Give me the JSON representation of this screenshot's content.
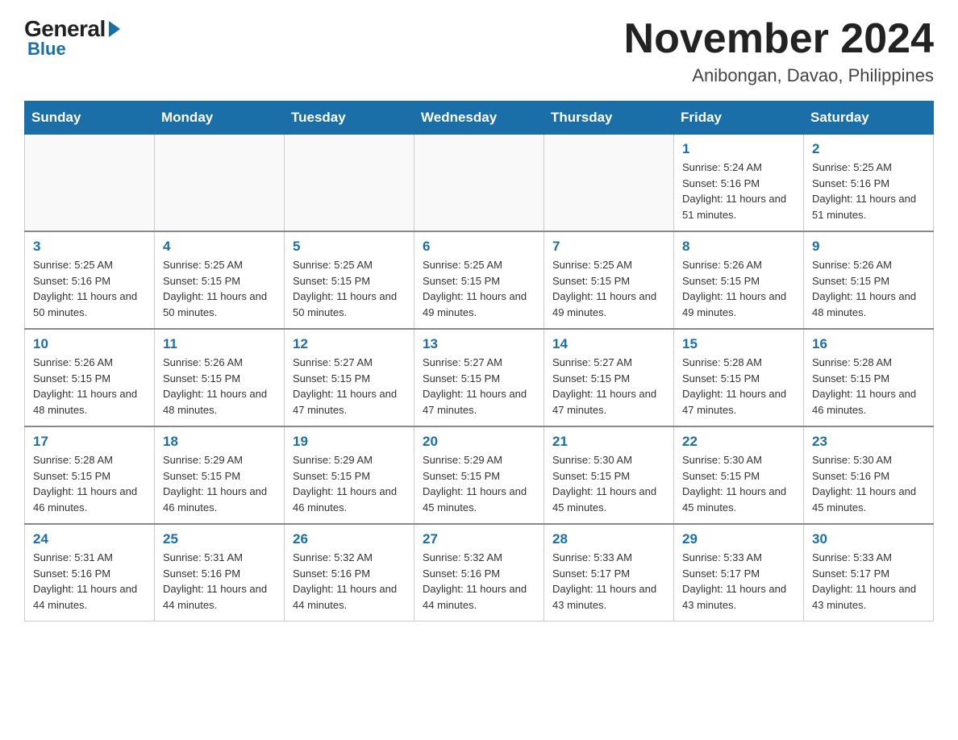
{
  "logo": {
    "general": "General",
    "blue": "Blue"
  },
  "title": {
    "month": "November 2024",
    "location": "Anibongan, Davao, Philippines"
  },
  "weekdays": [
    "Sunday",
    "Monday",
    "Tuesday",
    "Wednesday",
    "Thursday",
    "Friday",
    "Saturday"
  ],
  "weeks": [
    [
      {
        "day": "",
        "info": ""
      },
      {
        "day": "",
        "info": ""
      },
      {
        "day": "",
        "info": ""
      },
      {
        "day": "",
        "info": ""
      },
      {
        "day": "",
        "info": ""
      },
      {
        "day": "1",
        "info": "Sunrise: 5:24 AM\nSunset: 5:16 PM\nDaylight: 11 hours and 51 minutes."
      },
      {
        "day": "2",
        "info": "Sunrise: 5:25 AM\nSunset: 5:16 PM\nDaylight: 11 hours and 51 minutes."
      }
    ],
    [
      {
        "day": "3",
        "info": "Sunrise: 5:25 AM\nSunset: 5:16 PM\nDaylight: 11 hours and 50 minutes."
      },
      {
        "day": "4",
        "info": "Sunrise: 5:25 AM\nSunset: 5:15 PM\nDaylight: 11 hours and 50 minutes."
      },
      {
        "day": "5",
        "info": "Sunrise: 5:25 AM\nSunset: 5:15 PM\nDaylight: 11 hours and 50 minutes."
      },
      {
        "day": "6",
        "info": "Sunrise: 5:25 AM\nSunset: 5:15 PM\nDaylight: 11 hours and 49 minutes."
      },
      {
        "day": "7",
        "info": "Sunrise: 5:25 AM\nSunset: 5:15 PM\nDaylight: 11 hours and 49 minutes."
      },
      {
        "day": "8",
        "info": "Sunrise: 5:26 AM\nSunset: 5:15 PM\nDaylight: 11 hours and 49 minutes."
      },
      {
        "day": "9",
        "info": "Sunrise: 5:26 AM\nSunset: 5:15 PM\nDaylight: 11 hours and 48 minutes."
      }
    ],
    [
      {
        "day": "10",
        "info": "Sunrise: 5:26 AM\nSunset: 5:15 PM\nDaylight: 11 hours and 48 minutes."
      },
      {
        "day": "11",
        "info": "Sunrise: 5:26 AM\nSunset: 5:15 PM\nDaylight: 11 hours and 48 minutes."
      },
      {
        "day": "12",
        "info": "Sunrise: 5:27 AM\nSunset: 5:15 PM\nDaylight: 11 hours and 47 minutes."
      },
      {
        "day": "13",
        "info": "Sunrise: 5:27 AM\nSunset: 5:15 PM\nDaylight: 11 hours and 47 minutes."
      },
      {
        "day": "14",
        "info": "Sunrise: 5:27 AM\nSunset: 5:15 PM\nDaylight: 11 hours and 47 minutes."
      },
      {
        "day": "15",
        "info": "Sunrise: 5:28 AM\nSunset: 5:15 PM\nDaylight: 11 hours and 47 minutes."
      },
      {
        "day": "16",
        "info": "Sunrise: 5:28 AM\nSunset: 5:15 PM\nDaylight: 11 hours and 46 minutes."
      }
    ],
    [
      {
        "day": "17",
        "info": "Sunrise: 5:28 AM\nSunset: 5:15 PM\nDaylight: 11 hours and 46 minutes."
      },
      {
        "day": "18",
        "info": "Sunrise: 5:29 AM\nSunset: 5:15 PM\nDaylight: 11 hours and 46 minutes."
      },
      {
        "day": "19",
        "info": "Sunrise: 5:29 AM\nSunset: 5:15 PM\nDaylight: 11 hours and 46 minutes."
      },
      {
        "day": "20",
        "info": "Sunrise: 5:29 AM\nSunset: 5:15 PM\nDaylight: 11 hours and 45 minutes."
      },
      {
        "day": "21",
        "info": "Sunrise: 5:30 AM\nSunset: 5:15 PM\nDaylight: 11 hours and 45 minutes."
      },
      {
        "day": "22",
        "info": "Sunrise: 5:30 AM\nSunset: 5:15 PM\nDaylight: 11 hours and 45 minutes."
      },
      {
        "day": "23",
        "info": "Sunrise: 5:30 AM\nSunset: 5:16 PM\nDaylight: 11 hours and 45 minutes."
      }
    ],
    [
      {
        "day": "24",
        "info": "Sunrise: 5:31 AM\nSunset: 5:16 PM\nDaylight: 11 hours and 44 minutes."
      },
      {
        "day": "25",
        "info": "Sunrise: 5:31 AM\nSunset: 5:16 PM\nDaylight: 11 hours and 44 minutes."
      },
      {
        "day": "26",
        "info": "Sunrise: 5:32 AM\nSunset: 5:16 PM\nDaylight: 11 hours and 44 minutes."
      },
      {
        "day": "27",
        "info": "Sunrise: 5:32 AM\nSunset: 5:16 PM\nDaylight: 11 hours and 44 minutes."
      },
      {
        "day": "28",
        "info": "Sunrise: 5:33 AM\nSunset: 5:17 PM\nDaylight: 11 hours and 43 minutes."
      },
      {
        "day": "29",
        "info": "Sunrise: 5:33 AM\nSunset: 5:17 PM\nDaylight: 11 hours and 43 minutes."
      },
      {
        "day": "30",
        "info": "Sunrise: 5:33 AM\nSunset: 5:17 PM\nDaylight: 11 hours and 43 minutes."
      }
    ]
  ]
}
